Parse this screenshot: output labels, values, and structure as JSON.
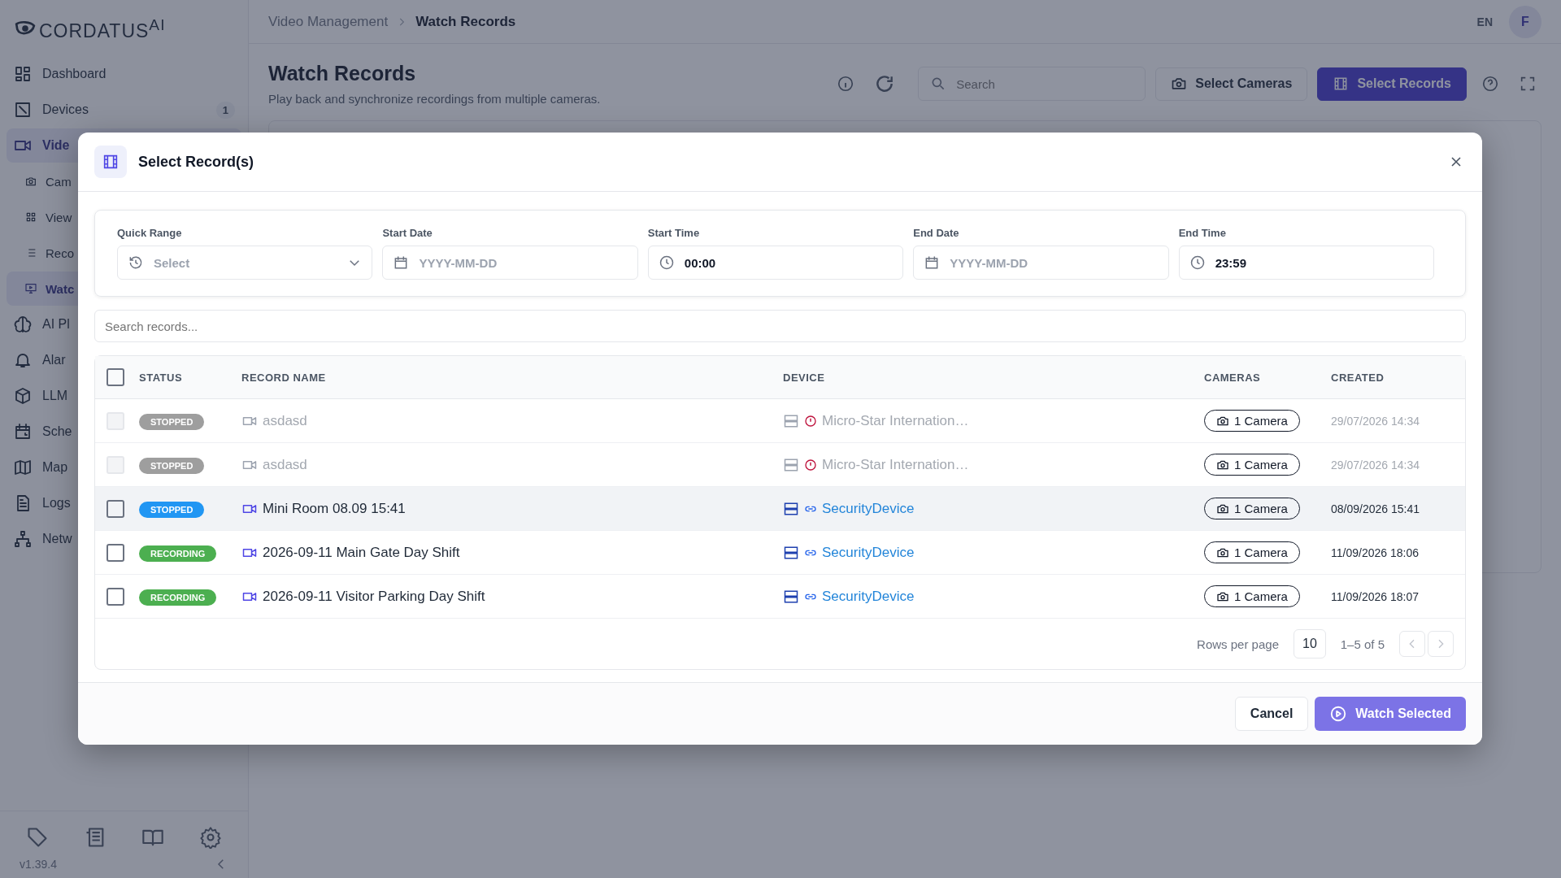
{
  "sidebar": {
    "logo": "CORDATUS$^{AI}$",
    "items": [
      {
        "label": "Dashboard",
        "selected": false
      },
      {
        "label": "Devices",
        "selected": false,
        "badge": "1"
      },
      {
        "label": "Vide",
        "selected": true,
        "children": [
          {
            "label": "Cam",
            "selected": false
          },
          {
            "label": "View",
            "selected": false
          },
          {
            "label": "Reco",
            "selected": false
          },
          {
            "label": "Watc",
            "selected": true
          }
        ]
      },
      {
        "label": "AI Pl",
        "selected": false
      },
      {
        "label": "Alar",
        "selected": false
      },
      {
        "label": "LLM",
        "selected": false
      },
      {
        "label": "Sche",
        "selected": false
      },
      {
        "label": "Map",
        "selected": false
      },
      {
        "label": "Logs",
        "selected": false
      },
      {
        "label": "Netw",
        "selected": false
      }
    ],
    "version": "v1.39.4"
  },
  "header": {
    "breadcrumb": [
      "Video Management",
      "Watch Records"
    ],
    "language": "EN",
    "avatar": "F"
  },
  "page": {
    "title": "Watch Records",
    "subtitle": "Play back and synchronize recordings from multiple cameras.",
    "search": {
      "placeholder": "Search"
    },
    "buttons": [
      "Select Cameras",
      "Select Records"
    ]
  },
  "dialog": {
    "title": "Select Record(s)",
    "filters": [
      {
        "kind": "select",
        "label": "Quick Range",
        "placeholder": "Select"
      },
      {
        "kind": "date",
        "label": "Start Date",
        "placeholder": "YYYY-MM-DD"
      },
      {
        "kind": "time",
        "label": "Start Time",
        "value": "00:00"
      },
      {
        "kind": "date",
        "label": "End Date",
        "placeholder": "YYYY-MM-DD"
      },
      {
        "kind": "time",
        "label": "End Time",
        "value": "23:59"
      }
    ],
    "search": {
      "placeholder": "Search records..."
    },
    "table": {
      "select_all": {
        "checked": false
      },
      "columns": [
        "STATUS",
        "RECORD NAME",
        "DEVICE",
        "CAMERAS",
        "CREATED"
      ],
      "rows": [
        {
          "checked": false,
          "disabled": true,
          "highlighted": false,
          "status": {
            "label": "STOPPED",
            "color": "#9e9e9e"
          },
          "name": "asdasd",
          "device": {
            "kind": "error",
            "name": "Micro-Star Internation…"
          },
          "cameras": "1 Camera",
          "created": "29/07/2026 14:34"
        },
        {
          "checked": false,
          "disabled": true,
          "highlighted": false,
          "status": {
            "label": "STOPPED",
            "color": "#9e9e9e"
          },
          "name": "asdasd",
          "device": {
            "kind": "error",
            "name": "Micro-Star Internation…"
          },
          "cameras": "1 Camera",
          "created": "29/07/2026 14:34"
        },
        {
          "checked": false,
          "disabled": false,
          "highlighted": true,
          "status": {
            "label": "STOPPED",
            "color": "#2196f3"
          },
          "name": "Mini Room 08.09 15:41",
          "device": {
            "kind": "linked",
            "name": "SecurityDevice"
          },
          "cameras": "1 Camera",
          "created": "08/09/2026 15:41"
        },
        {
          "checked": false,
          "disabled": false,
          "highlighted": false,
          "status": {
            "label": "RECORDING",
            "color": "#4caf50"
          },
          "name": "2026-09-11 Main Gate Day Shift",
          "device": {
            "kind": "linked",
            "name": "SecurityDevice"
          },
          "cameras": "1 Camera",
          "created": "11/09/2026 18:06"
        },
        {
          "checked": false,
          "disabled": false,
          "highlighted": false,
          "status": {
            "label": "RECORDING",
            "color": "#4caf50"
          },
          "name": "2026-09-11 Visitor Parking Day Shift",
          "device": {
            "kind": "linked",
            "name": "SecurityDevice"
          },
          "cameras": "1 Camera",
          "created": "11/09/2026 18:07"
        }
      ],
      "pagination": {
        "rows_label": "Rows per page",
        "rows_value": "10",
        "range": "1–5 of 5"
      }
    },
    "buttons": [
      "Cancel",
      "Watch Selected"
    ]
  }
}
